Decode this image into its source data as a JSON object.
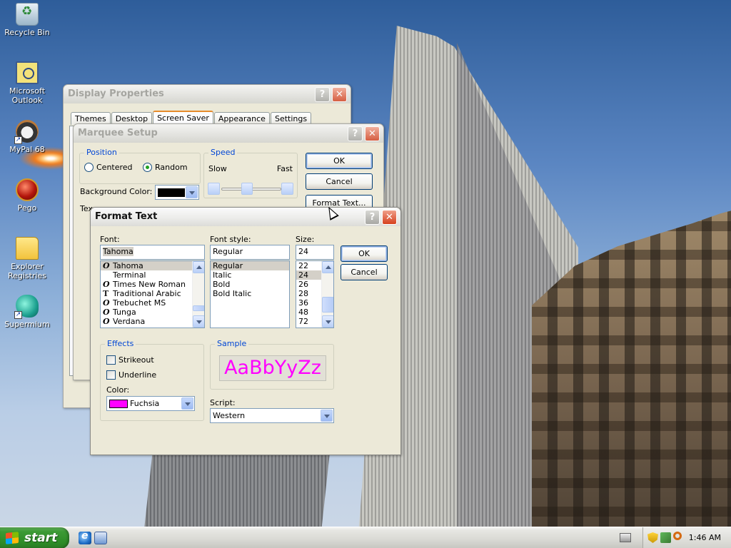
{
  "desktop": {
    "icons": [
      {
        "label": "Recycle Bin",
        "icon": "recycle-bin-icon"
      },
      {
        "label": "Microsoft Outlook",
        "icon": "outlook-icon"
      },
      {
        "label": "MyPal 68",
        "icon": "mypal-browser-icon"
      },
      {
        "label": "Pego",
        "icon": "pego-icon"
      },
      {
        "label": "Explorer Registries",
        "icon": "folder-icon"
      },
      {
        "label": "Supermium",
        "icon": "supermium-browser-icon"
      }
    ]
  },
  "display_properties": {
    "title": "Display Properties",
    "tabs": [
      "Themes",
      "Desktop",
      "Screen Saver",
      "Appearance",
      "Settings"
    ],
    "selected_tab": "Screen Saver"
  },
  "marquee_setup": {
    "title": "Marquee Setup",
    "position": {
      "legend": "Position",
      "options": [
        "Centered",
        "Random"
      ],
      "selected": "Random"
    },
    "speed": {
      "legend": "Speed",
      "slow_label": "Slow",
      "fast_label": "Fast"
    },
    "background_color_label": "Background Color:",
    "background_color_value": "#000000",
    "text_label_partial": "Tex",
    "ok_label": "OK",
    "cancel_label": "Cancel",
    "format_text_label": "Format Text..."
  },
  "format_text": {
    "title": "Format Text",
    "font_label": "Font:",
    "font_value": "Tahoma",
    "fonts": [
      {
        "name": "Tahoma",
        "glyph": "O",
        "type": "opentype"
      },
      {
        "name": "Terminal",
        "glyph": "",
        "type": "raster"
      },
      {
        "name": "Times New Roman",
        "glyph": "O",
        "type": "opentype"
      },
      {
        "name": "Traditional Arabic",
        "glyph": "T",
        "type": "truetype"
      },
      {
        "name": "Trebuchet MS",
        "glyph": "O",
        "type": "opentype"
      },
      {
        "name": "Tunga",
        "glyph": "O",
        "type": "opentype"
      },
      {
        "name": "Verdana",
        "glyph": "O",
        "type": "opentype"
      }
    ],
    "selected_font": "Tahoma",
    "style_label": "Font style:",
    "style_value": "Regular",
    "styles": [
      "Regular",
      "Italic",
      "Bold",
      "Bold Italic"
    ],
    "selected_style": "Regular",
    "size_label": "Size:",
    "size_value": "24",
    "sizes": [
      "22",
      "24",
      "26",
      "28",
      "36",
      "48",
      "72"
    ],
    "selected_size": "24",
    "ok_label": "OK",
    "cancel_label": "Cancel",
    "effects": {
      "legend": "Effects",
      "strikeout_label": "Strikeout",
      "underline_label": "Underline",
      "color_label": "Color:",
      "color_value": "Fuchsia",
      "color_swatch": "#ff00ff"
    },
    "sample": {
      "legend": "Sample",
      "text": "AaBbYyZz",
      "color": "#ff00ff"
    },
    "script_label": "Script:",
    "script_value": "Western"
  },
  "taskbar": {
    "start_label": "start",
    "quick_launch": [
      "internet-explorer-icon",
      "show-desktop-icon"
    ],
    "tray_icons": [
      "security-shield-icon",
      "network-icon",
      "search-icon"
    ],
    "clock": "1:46 AM"
  }
}
